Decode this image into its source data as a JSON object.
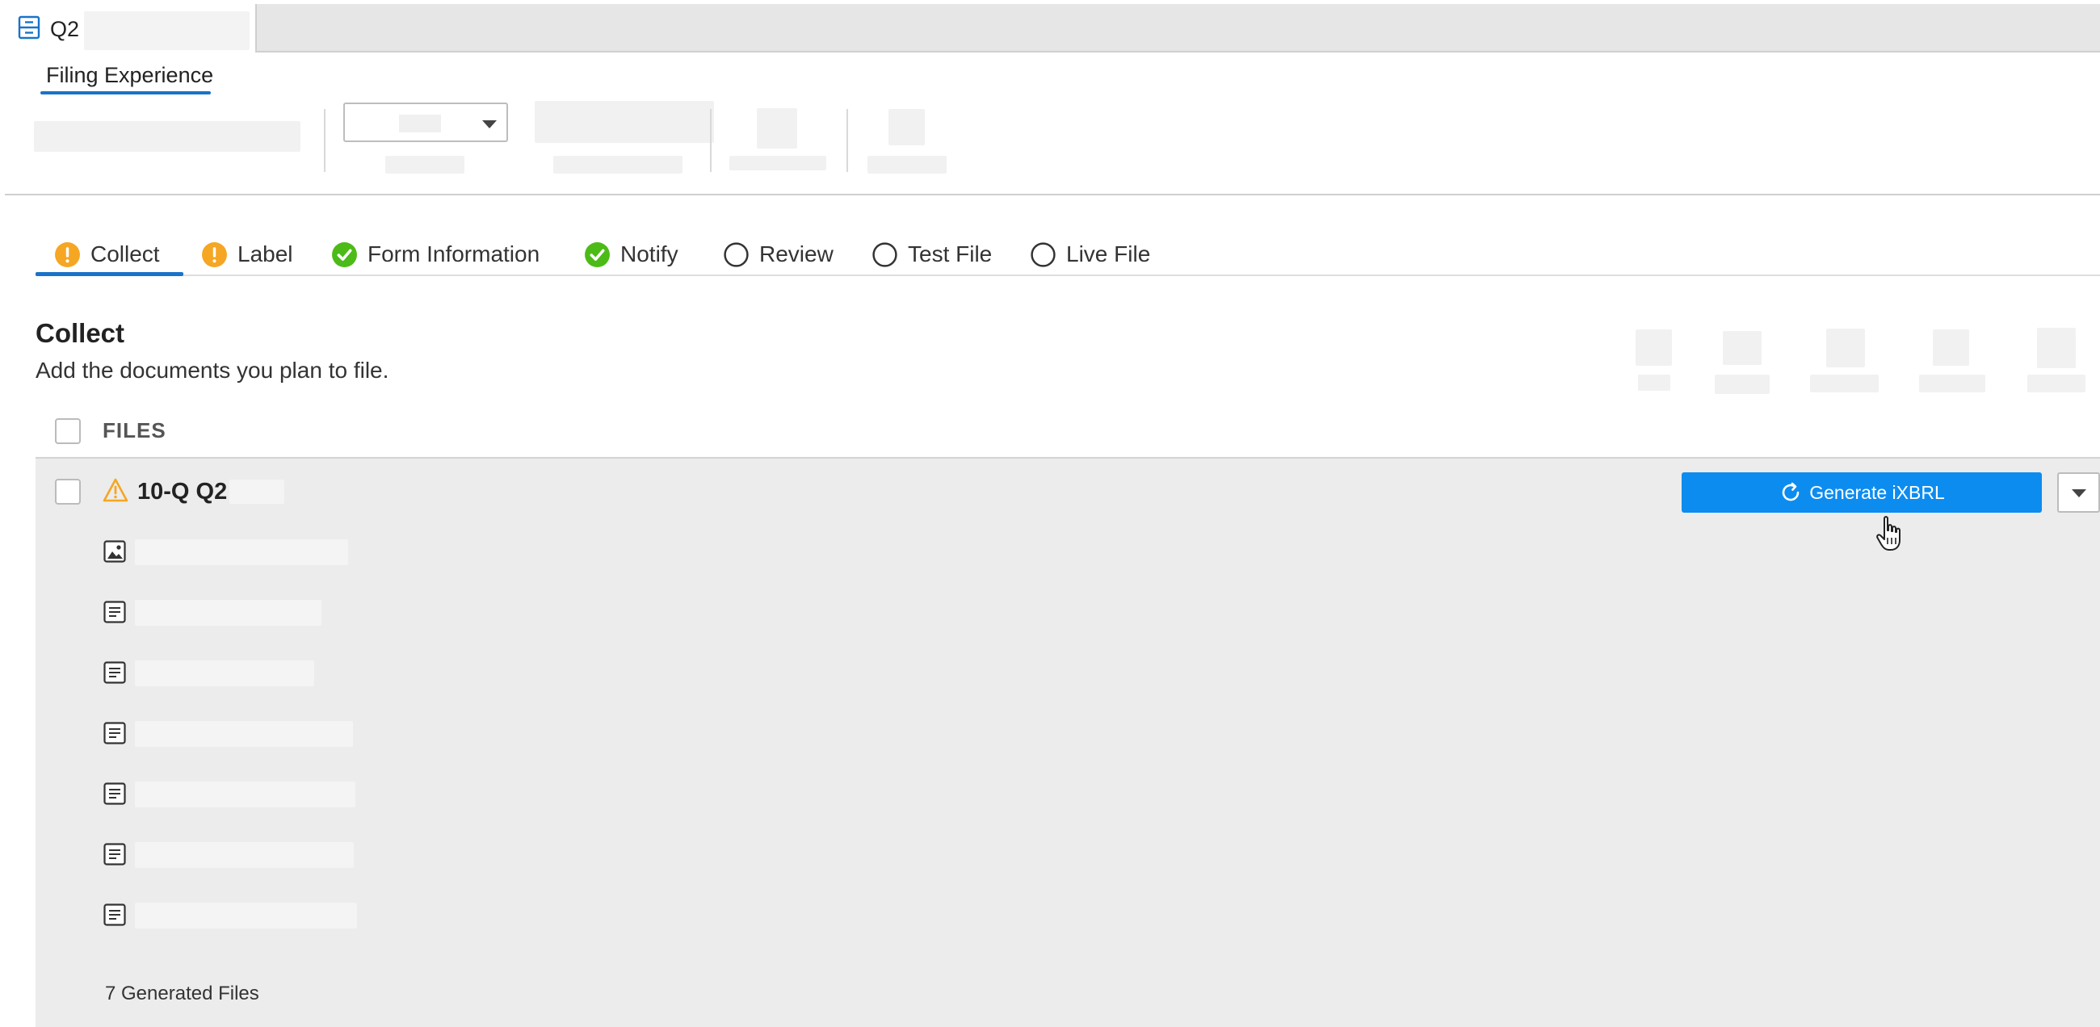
{
  "window": {
    "doc_title": "Q2",
    "doc_icon": "document-stack-icon"
  },
  "subnav": {
    "label": "Filing Experience"
  },
  "steps": [
    {
      "label": "Collect",
      "status": "warning"
    },
    {
      "label": "Label",
      "status": "warning"
    },
    {
      "label": "Form Information",
      "status": "complete"
    },
    {
      "label": "Notify",
      "status": "complete"
    },
    {
      "label": "Review",
      "status": "pending"
    },
    {
      "label": "Test File",
      "status": "pending"
    },
    {
      "label": "Live File",
      "status": "pending"
    }
  ],
  "section": {
    "title": "Collect",
    "subtitle": "Add the documents you plan to file."
  },
  "files_table": {
    "header": "FILES"
  },
  "group": {
    "title": "10-Q Q2",
    "generate_label": "Generate iXBRL",
    "generated_count_label": "7 Generated Files",
    "files": [
      {
        "icon": "image-file-icon"
      },
      {
        "icon": "text-file-icon"
      },
      {
        "icon": "text-file-icon"
      },
      {
        "icon": "text-file-icon"
      },
      {
        "icon": "text-file-icon"
      },
      {
        "icon": "text-file-icon"
      },
      {
        "icon": "text-file-icon"
      }
    ]
  },
  "colors": {
    "accent": "#1a73c8",
    "button": "#0d8cf0",
    "warning": "#f5a623",
    "success": "#4cbb17",
    "panel_bg": "#ececec"
  }
}
